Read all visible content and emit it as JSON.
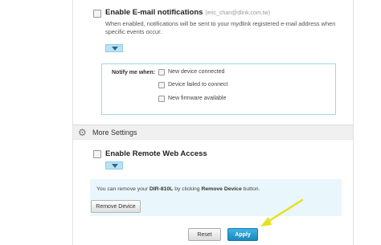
{
  "email_section": {
    "title": "Enable E-mail notifications",
    "email": "(eric_chan@dlink.com.tw)",
    "description": "When enabled, notifications will be sent to your mydlink registered e-mail address when specific events occur."
  },
  "notify": {
    "label": "Notify me when:",
    "options": [
      {
        "label": "New device connected"
      },
      {
        "label": "Device failed to connect"
      },
      {
        "label": "New firmware available"
      }
    ]
  },
  "more_settings": {
    "title": "More Settings",
    "remote_access_label": "Enable Remote Web Access"
  },
  "remove": {
    "text_before": "You can remove your",
    "device_model": "DIR-810L",
    "text_middle": "by clicking",
    "button_ref": "Remove Device",
    "text_after": "button.",
    "button_label": "Remove Device"
  },
  "actions": {
    "reset_label": "Reset",
    "apply_label": "Apply"
  },
  "colors": {
    "accent": "#1a86bd",
    "toggle": "#b9e3f5",
    "info_bg": "#e9f6fb",
    "annotation_arrow": "#e8e020"
  },
  "icons": {
    "settings": "gear-icon",
    "expand": "chevron-down-icon",
    "annotation": "arrow-annotation"
  }
}
